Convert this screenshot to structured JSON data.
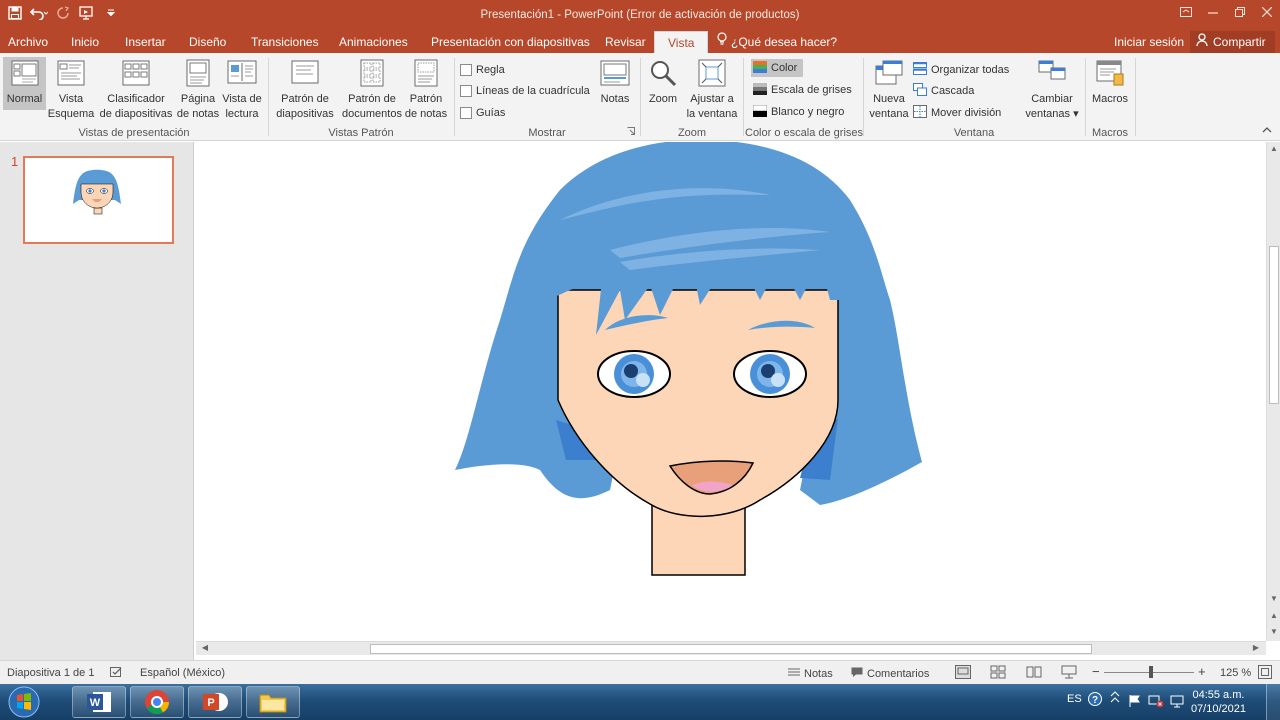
{
  "window": {
    "title": "Presentación1 - PowerPoint (Error de activación de productos)"
  },
  "tabs": [
    {
      "label": "Archivo"
    },
    {
      "label": "Inicio"
    },
    {
      "label": "Insertar"
    },
    {
      "label": "Diseño"
    },
    {
      "label": "Transiciones"
    },
    {
      "label": "Animaciones"
    },
    {
      "label": "Presentación con diapositivas"
    },
    {
      "label": "Revisar"
    },
    {
      "label": "Vista"
    }
  ],
  "tell_me": "¿Qué desea hacer?",
  "sign_in": "Iniciar sesión",
  "share": "Compartir",
  "ribbon": {
    "presentation_views": {
      "label": "Vistas de presentación",
      "normal": "Normal",
      "outline_1": "Vista",
      "outline_2": "Esquema",
      "sorter_1": "Clasificador",
      "sorter_2": "de diapositivas",
      "notes_page_1": "Página",
      "notes_page_2": "de notas",
      "reading_1": "Vista de",
      "reading_2": "lectura"
    },
    "master_views": {
      "label": "Vistas Patrón",
      "slide_master_1": "Patrón de",
      "slide_master_2": "diapositivas",
      "handout_master_1": "Patrón de",
      "handout_master_2": "documentos",
      "notes_master_1": "Patrón",
      "notes_master_2": "de notas"
    },
    "show": {
      "label": "Mostrar",
      "ruler": "Regla",
      "gridlines": "Líneas de la cuadrícula",
      "guides": "Guías",
      "notes": "Notas"
    },
    "zoom": {
      "label": "Zoom",
      "zoom": "Zoom",
      "fit_1": "Ajustar a",
      "fit_2": "la ventana"
    },
    "color": {
      "label": "Color o escala de grises",
      "color": "Color",
      "grayscale": "Escala de grises",
      "bw": "Blanco y negro"
    },
    "window": {
      "label": "Ventana",
      "new_1": "Nueva",
      "new_2": "ventana",
      "arrange": "Organizar todas",
      "cascade": "Cascada",
      "move_split": "Mover división",
      "switch_1": "Cambiar",
      "switch_2": "ventanas"
    },
    "macros": {
      "label": "Macros",
      "macros": "Macros"
    }
  },
  "slides": [
    {
      "number": "1"
    }
  ],
  "status": {
    "slide_of": "Diapositiva 1 de 1",
    "language": "Español (México)",
    "notes": "Notas",
    "comments": "Comentarios",
    "zoom": "125 %"
  },
  "taskbar": {
    "lang": "ES",
    "time": "04:55 a.m.",
    "date": "07/10/2021"
  },
  "colors": {
    "accent": "#b7472a",
    "hair": "#5b9bd5",
    "skin": "#fdd6b8"
  }
}
